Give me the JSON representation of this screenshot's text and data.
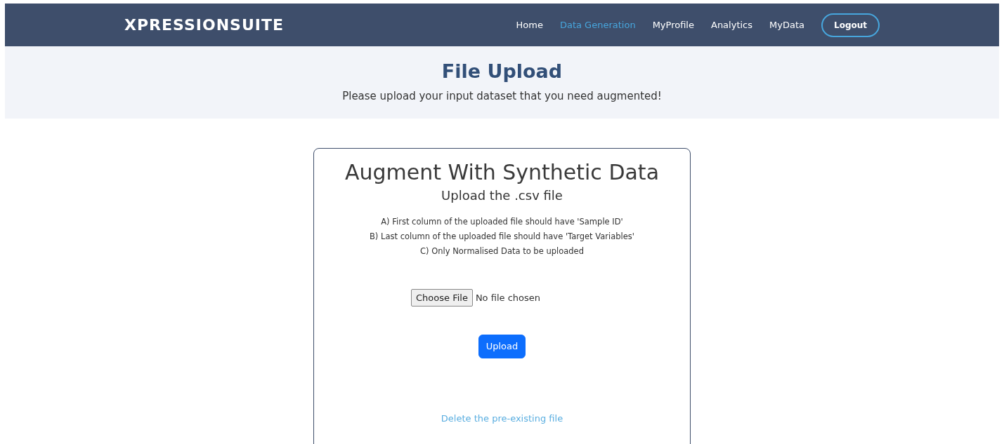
{
  "navbar": {
    "brand": "XPRESSIONSUITE",
    "links": [
      {
        "label": "Home",
        "selected": false
      },
      {
        "label": "Data Generation",
        "selected": true
      },
      {
        "label": "MyProfile",
        "selected": false
      },
      {
        "label": "Analytics",
        "selected": false
      },
      {
        "label": "MyData",
        "selected": false
      }
    ],
    "logout_button": "Logout"
  },
  "header": {
    "title": "File Upload",
    "subtitle": "Please upload your input dataset that you need augmented!"
  },
  "card": {
    "title": "Augment With Synthetic Data",
    "subtitle": "Upload the .csv file",
    "instructions": [
      "A) First column of the uploaded file should have 'Sample ID'",
      "B) Last column of the uploaded file should have 'Target Variables'",
      "C) Only Normalised Data to be uploaded"
    ],
    "file_input": {
      "button": "Choose File",
      "status": "No file chosen"
    },
    "upload_button": "Upload",
    "delete_link": "Delete the pre-existing file"
  }
}
